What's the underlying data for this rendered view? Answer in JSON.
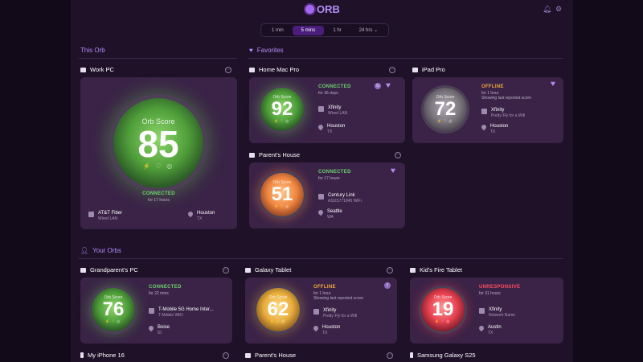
{
  "app": {
    "logo": "ORB"
  },
  "time_range": {
    "options": [
      "1 min",
      "5 mins",
      "1 hr",
      "24 hrs"
    ],
    "selected": "5 mins"
  },
  "sections": {
    "this_orb": "This Orb",
    "favorites": "Favorites",
    "your_orbs": "Your Orbs"
  },
  "work_pc": {
    "name": "Work PC",
    "score_label": "Orb Score",
    "score": "85",
    "status": "CONNECTED",
    "duration": "for 17 hours",
    "isp": "AT&T Fiber",
    "connection": "Wired LAN",
    "city": "Houston",
    "state": "TX"
  },
  "home_mac": {
    "name": "Home Mac Pro",
    "score_label": "Orb Score",
    "score": "92",
    "status": "CONNECTED",
    "duration": "for 36 days",
    "isp": "Xfinity",
    "connection": "Wired LAN",
    "city": "Houston",
    "state": "TX"
  },
  "ipad": {
    "name": "iPad Pro",
    "score_label": "Orb Score",
    "score": "72",
    "status": "OFFLINE",
    "duration": "for 1 hour",
    "note": "Showing last reported score",
    "isp": "Xfinity",
    "connection": "Pretty Fly for a Wifi",
    "city": "Houston",
    "state": "TX"
  },
  "parents": {
    "name": "Parent's House",
    "score_label": "Orb Score",
    "score": "51",
    "status": "CONNECTED",
    "duration": "for 17 hours",
    "isp": "Century Link",
    "connection": "ASUS771845 WiFi",
    "city": "Seattle",
    "state": "WA"
  },
  "grandparent": {
    "name": "Grandparent's PC",
    "score_label": "Orb Score",
    "score": "76",
    "status": "CONNECTED",
    "duration": "for 22 mins",
    "isp": "T-Mobile 5G Home Inter...",
    "connection": "T-Mobile WiFi",
    "city": "Boise",
    "state": "ID"
  },
  "galaxy_tab": {
    "name": "Galaxy Tablet",
    "score_label": "Orb Score",
    "score": "62",
    "status": "OFFLINE",
    "duration": "for 1 hour",
    "note": "Showing last reported score",
    "isp": "Xfinity",
    "connection": "Pretty Fly for a Wifi",
    "city": "Houston",
    "state": "TX"
  },
  "kids_fire": {
    "name": "Kid's Fire Tablet",
    "score_label": "Orb Score",
    "score": "19",
    "status": "UNRESPONSIVE",
    "duration": "for 31 hours",
    "isp": "Xfinity",
    "connection": "Network Name",
    "city": "Austin",
    "state": "TX"
  },
  "bottom_row": {
    "iphone": "My iPhone 16",
    "parents2": "Parent's House",
    "samsung": "Samsung Galaxy S25"
  },
  "colors": {
    "accent": "#b58cf5",
    "connected": "#6ed26e",
    "offline": "#f0a83c",
    "unresponsive": "#ff4d5e"
  }
}
